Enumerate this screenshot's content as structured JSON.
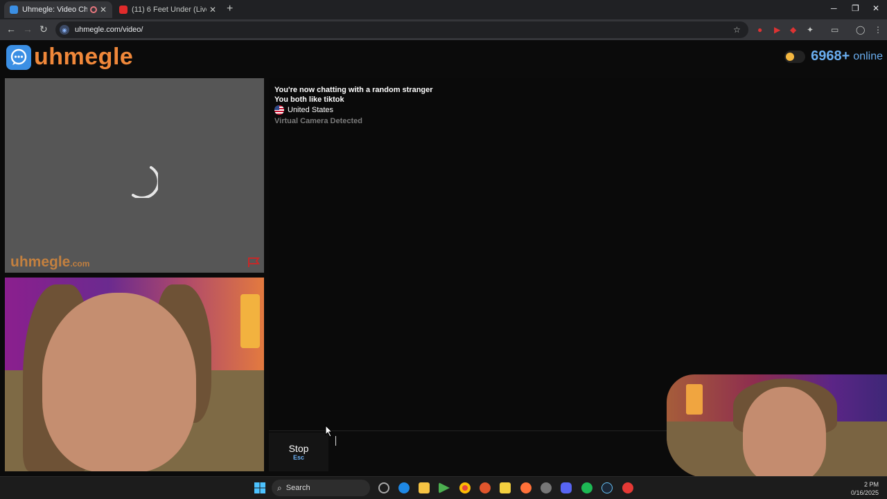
{
  "browser": {
    "tabs": [
      {
        "title": "Uhmegle: Video Chat | Ome",
        "active": true
      },
      {
        "title": "(11) 6 Feet Under (Live From M",
        "active": false
      }
    ],
    "url": "uhmegle.com/video/"
  },
  "header": {
    "logo_text": "uhmegle",
    "online_count": "6968+",
    "online_label": "online"
  },
  "stranger_video": {
    "watermark": "uhmegle",
    "watermark_suffix": ".com"
  },
  "chat": {
    "messages": [
      "You're now chatting with a random stranger",
      "You both like tiktok"
    ],
    "country": "United States",
    "notice": "Virtual Camera Detected"
  },
  "controls": {
    "stop_label": "Stop",
    "stop_shortcut": "Esc",
    "chat_input_value": ""
  },
  "taskbar": {
    "search_placeholder": "Search",
    "clock_time": "2 PM",
    "clock_date": "0/16/2025"
  },
  "colors": {
    "brand_orange": "#f0883a",
    "brand_blue": "#3b8fe4",
    "online_blue": "#6aaef0"
  }
}
